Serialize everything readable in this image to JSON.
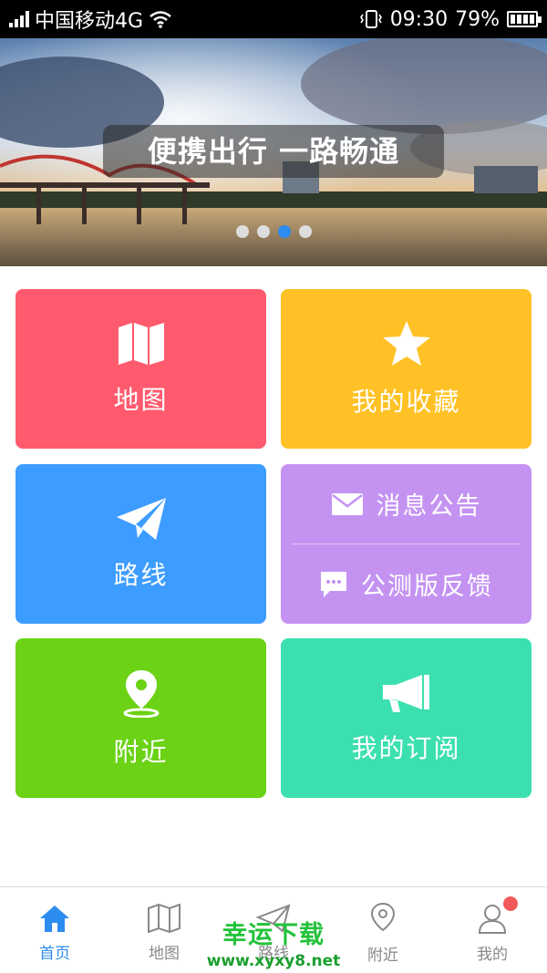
{
  "status_bar": {
    "carrier": "中国移动4G",
    "time": "09:30",
    "battery": "79%"
  },
  "banner": {
    "caption": "便携出行 一路畅通",
    "dot_count": 4,
    "active_dot": 3
  },
  "tiles": {
    "map": {
      "label": "地图",
      "icon": "map-icon",
      "color": "#ff5a6e"
    },
    "favorites": {
      "label": "我的收藏",
      "icon": "star-icon",
      "color": "#ffc125"
    },
    "route": {
      "label": "路线",
      "icon": "paper-plane-icon",
      "color": "#3d9cff"
    },
    "notice": {
      "label": "消息公告",
      "icon": "envelope-icon",
      "color": "#c493f2"
    },
    "feedback": {
      "label": "公测版反馈",
      "icon": "chat-bubble-icon",
      "color": "#c493f2"
    },
    "nearby": {
      "label": "附近",
      "icon": "location-pin-icon",
      "color": "#6bd216"
    },
    "subscriptions": {
      "label": "我的订阅",
      "icon": "megaphone-icon",
      "color": "#3ce0b0"
    }
  },
  "bottom_nav": {
    "items": [
      {
        "label": "首页",
        "icon": "home-icon",
        "active": true
      },
      {
        "label": "地图",
        "icon": "map-icon",
        "active": false
      },
      {
        "label": "路线",
        "icon": "paper-plane-icon",
        "active": false
      },
      {
        "label": "附近",
        "icon": "location-pin-icon",
        "active": false
      },
      {
        "label": "我的",
        "icon": "user-icon",
        "active": false,
        "badge": true
      }
    ],
    "active_color": "#2d8cf0",
    "inactive_color": "#888888"
  },
  "watermark": {
    "title": "幸运下载",
    "url": "www.xyxy8.net"
  }
}
